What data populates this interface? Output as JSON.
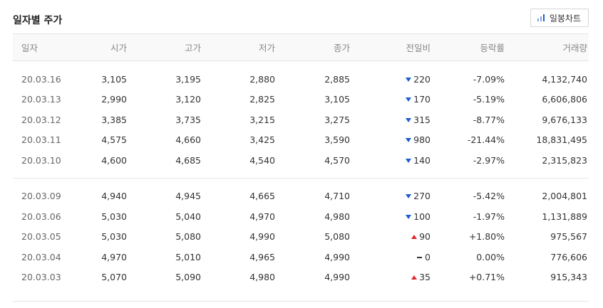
{
  "header": {
    "title": "일자별 주가",
    "chart_button_label": "일봉차트",
    "chart_button_icon": "bar-chart-icon"
  },
  "colors": {
    "down": "#1d5bd1",
    "up": "#e0262d",
    "header_bg": "#f9f9f9",
    "border": "#e4e4e4"
  },
  "table": {
    "columns": [
      "일자",
      "시가",
      "고가",
      "저가",
      "종가",
      "전일비",
      "등락률",
      "거래량"
    ],
    "groups": [
      [
        {
          "date": "20.03.16",
          "open": "3,105",
          "high": "3,195",
          "low": "2,880",
          "close": "2,885",
          "dir": "down",
          "change": "220",
          "rate": "-7.09%",
          "volume": "4,132,740"
        },
        {
          "date": "20.03.13",
          "open": "2,990",
          "high": "3,120",
          "low": "2,825",
          "close": "3,105",
          "dir": "down",
          "change": "170",
          "rate": "-5.19%",
          "volume": "6,606,806"
        },
        {
          "date": "20.03.12",
          "open": "3,385",
          "high": "3,735",
          "low": "3,215",
          "close": "3,275",
          "dir": "down",
          "change": "315",
          "rate": "-8.77%",
          "volume": "9,676,133"
        },
        {
          "date": "20.03.11",
          "open": "4,575",
          "high": "4,660",
          "low": "3,425",
          "close": "3,590",
          "dir": "down",
          "change": "980",
          "rate": "-21.44%",
          "volume": "18,831,495"
        },
        {
          "date": "20.03.10",
          "open": "4,600",
          "high": "4,685",
          "low": "4,540",
          "close": "4,570",
          "dir": "down",
          "change": "140",
          "rate": "-2.97%",
          "volume": "2,315,823"
        }
      ],
      [
        {
          "date": "20.03.09",
          "open": "4,940",
          "high": "4,945",
          "low": "4,665",
          "close": "4,710",
          "dir": "down",
          "change": "270",
          "rate": "-5.42%",
          "volume": "2,004,801"
        },
        {
          "date": "20.03.06",
          "open": "5,030",
          "high": "5,040",
          "low": "4,970",
          "close": "4,980",
          "dir": "down",
          "change": "100",
          "rate": "-1.97%",
          "volume": "1,131,889"
        },
        {
          "date": "20.03.05",
          "open": "5,030",
          "high": "5,080",
          "low": "4,990",
          "close": "5,080",
          "dir": "up",
          "change": "90",
          "rate": "+1.80%",
          "volume": "975,567"
        },
        {
          "date": "20.03.04",
          "open": "4,970",
          "high": "5,010",
          "low": "4,965",
          "close": "4,990",
          "dir": "flat",
          "change": "0",
          "rate": "0.00%",
          "volume": "776,606"
        },
        {
          "date": "20.03.03",
          "open": "5,070",
          "high": "5,090",
          "low": "4,980",
          "close": "4,990",
          "dir": "up",
          "change": "35",
          "rate": "+0.71%",
          "volume": "915,343"
        }
      ]
    ]
  }
}
